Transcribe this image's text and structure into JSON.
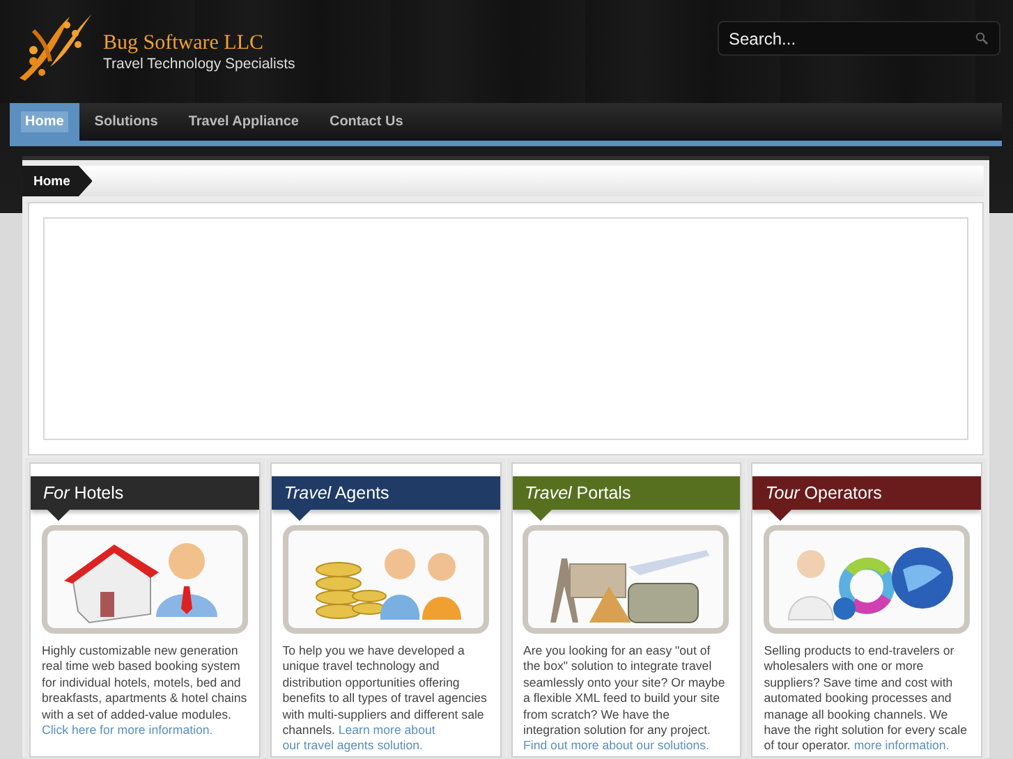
{
  "header": {
    "company": "Bug Software LLC",
    "tagline": "Travel Technology Specialists",
    "search": {
      "placeholder": "Search..."
    }
  },
  "nav": [
    {
      "label": "Home",
      "selected": true
    },
    {
      "label": "Solutions",
      "selected": false
    },
    {
      "label": "Travel Appliance",
      "selected": false
    },
    {
      "label": "Contact Us",
      "selected": false
    }
  ],
  "breadcrumb": "Home",
  "cards": [
    {
      "title": "*For* Hotels",
      "color": "#2b2b2b",
      "text": "Highly customizable new generation real time web based booking system for individual hotels, motels, bed and breakfasts, apartments & hotel chains with a set of added-value modules.",
      "link": "Click here for more information."
    },
    {
      "title": "*Travel* Agents",
      "color": "#1f3b66",
      "text": "To help you we have developed a unique travel technology and distribution opportunities offering benefits to all types of travel agencies with multi-suppliers and different sale channels.",
      "link": "Learn more about our travel agents solution."
    },
    {
      "title": "*Travel* Portals",
      "color": "#56701f",
      "text": "Are you looking for an easy \"out of the box\" solution to integrate travel seamlessly onto your site? Or maybe a flexible XML feed to build your site from scratch? We have the integration solution for any project.",
      "link": "Find out more about our solutions."
    },
    {
      "title": "*Tour* Operators",
      "color": "#6a1b1b",
      "text": "Selling products to end-travelers or wholesalers with one or more suppliers? Save time and cost with automated booking processes and manage all booking channels. We have the right solution for every scale of tour operator.",
      "link": "more information."
    }
  ]
}
